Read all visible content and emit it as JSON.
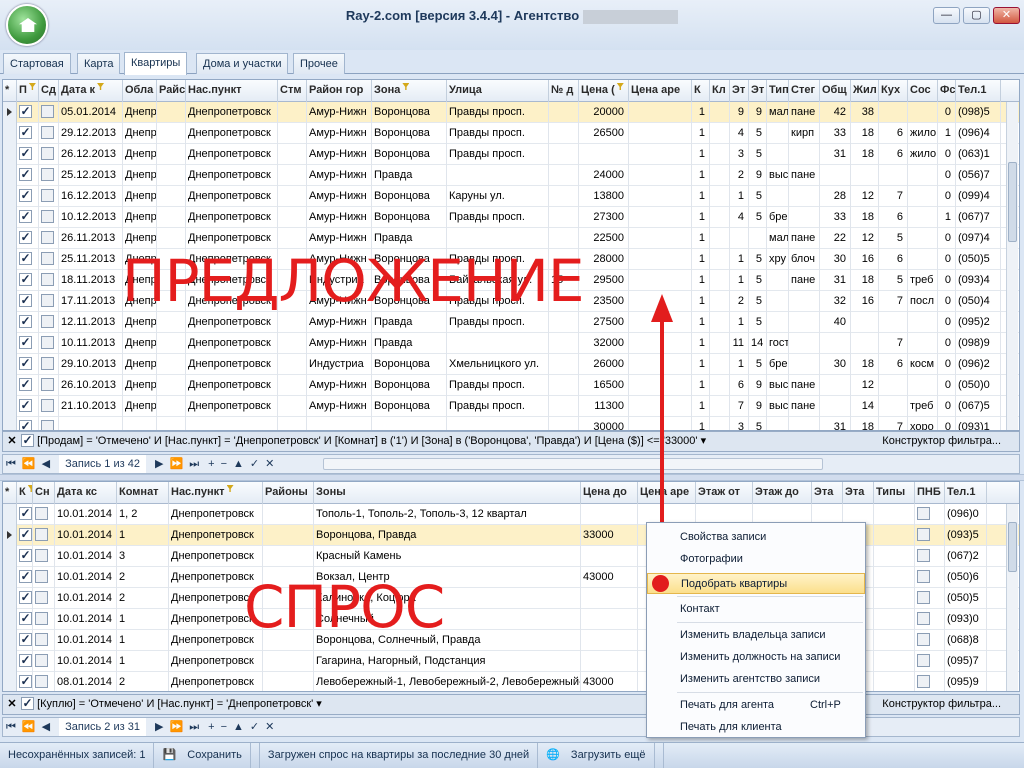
{
  "window": {
    "title": "Ray-2.com [версия 3.4.4] - Агентство",
    "min": "—",
    "max": "▢",
    "close": "✕"
  },
  "tabs": [
    {
      "label": "Стартовая"
    },
    {
      "label": "Карта"
    },
    {
      "label": "Квартиры"
    },
    {
      "label": "Дома и участки"
    },
    {
      "label": "Прочее"
    }
  ],
  "offers": {
    "headers": [
      "*",
      "П",
      "Сд",
      "Дата к",
      "Обла",
      "Райс",
      "Нас.пункт",
      "Стм",
      "Район гор",
      "Зона",
      "Улица",
      "№ д",
      "Цена (",
      "Цена аре",
      "К",
      "Кл",
      "Эт",
      "Эт",
      "Тип",
      "Стег",
      "Общ",
      "Жил",
      "Кух",
      "Сос",
      "Фс",
      "Тел.1"
    ],
    "rows": [
      [
        "05.01.2014",
        "Днепр",
        "",
        "Днепропетровск",
        "",
        "Амур-Нижн",
        "Воронцова",
        "Правды просп.",
        "",
        "20000",
        "",
        "1",
        "",
        "9",
        "9",
        "мал",
        "пане",
        "42",
        "38",
        "",
        "",
        "0",
        "(098)5"
      ],
      [
        "29.12.2013",
        "Днепр",
        "",
        "Днепропетровск",
        "",
        "Амур-Нижн",
        "Воронцова",
        "Правды просп.",
        "",
        "26500",
        "",
        "1",
        "",
        "4",
        "5",
        "",
        "кирп",
        "33",
        "18",
        "6",
        "жило",
        "1",
        "(096)4"
      ],
      [
        "26.12.2013",
        "Днепр",
        "",
        "Днепропетровск",
        "",
        "Амур-Нижн",
        "Воронцова",
        "Правды просп.",
        "",
        "",
        "",
        "1",
        "",
        "3",
        "5",
        "",
        "",
        "31",
        "18",
        "6",
        "жило",
        "0",
        "(063)1"
      ],
      [
        "25.12.2013",
        "Днепр",
        "",
        "Днепропетровск",
        "",
        "Амур-Нижн",
        "Правда",
        "",
        "",
        "24000",
        "",
        "1",
        "",
        "2",
        "9",
        "выс",
        "пане",
        "",
        "",
        "",
        "",
        "0",
        "(056)7"
      ],
      [
        "16.12.2013",
        "Днепр",
        "",
        "Днепропетровск",
        "",
        "Амур-Нижн",
        "Воронцова",
        "Каруны ул.",
        "",
        "13800",
        "",
        "1",
        "",
        "1",
        "5",
        "",
        "",
        "28",
        "12",
        "7",
        "",
        "0",
        "(099)4"
      ],
      [
        "10.12.2013",
        "Днепр",
        "",
        "Днепропетровск",
        "",
        "Амур-Нижн",
        "Воронцова",
        "Правды просп.",
        "",
        "27300",
        "",
        "1",
        "",
        "4",
        "5",
        "бре",
        "",
        "33",
        "18",
        "6",
        "",
        "1",
        "(067)7"
      ],
      [
        "26.11.2013",
        "Днепр",
        "",
        "Днепропетровск",
        "",
        "Амур-Нижн",
        "Правда",
        "",
        "",
        "22500",
        "",
        "1",
        "",
        "",
        "",
        "мал",
        "пане",
        "22",
        "12",
        "5",
        "",
        "0",
        "(097)4"
      ],
      [
        "25.11.2013",
        "Днепр",
        "",
        "Днепропетровск",
        "",
        "Амур-Нижн",
        "Воронцова",
        "Правды просп.",
        "",
        "28000",
        "",
        "1",
        "",
        "1",
        "5",
        "хру",
        "блоч",
        "30",
        "16",
        "6",
        "",
        "0",
        "(050)5"
      ],
      [
        "18.11.2013",
        "Днепр",
        "",
        "Днепропетровск",
        "",
        "Индустриа",
        "Воронцова",
        "Байкальская ул.",
        "15",
        "29500",
        "",
        "1",
        "",
        "1",
        "5",
        "",
        "пане",
        "31",
        "18",
        "5",
        "треб",
        "0",
        "(093)4"
      ],
      [
        "17.11.2013",
        "Днепр",
        "",
        "Днепропетровск",
        "",
        "Амур-Нижн",
        "Воронцова",
        "Правды просп.",
        "",
        "23500",
        "",
        "1",
        "",
        "2",
        "5",
        "",
        "",
        "32",
        "16",
        "7",
        "посл",
        "0",
        "(050)4"
      ],
      [
        "12.11.2013",
        "Днепр",
        "",
        "Днепропетровск",
        "",
        "Амур-Нижн",
        "Правда",
        "Правды просп.",
        "",
        "27500",
        "",
        "1",
        "",
        "1",
        "5",
        "",
        "",
        "40",
        "",
        "",
        "",
        "0",
        "(095)2"
      ],
      [
        "10.11.2013",
        "Днепр",
        "",
        "Днепропетровск",
        "",
        "Амур-Нижн",
        "Правда",
        "",
        "",
        "32000",
        "",
        "1",
        "",
        "11",
        "14",
        "гост",
        "",
        "",
        "",
        "7",
        "",
        "0",
        "(098)9"
      ],
      [
        "29.10.2013",
        "Днепр",
        "",
        "Днепропетровск",
        "",
        "Индустриа",
        "Воронцова",
        "Хмельницкого ул.",
        "",
        "26000",
        "",
        "1",
        "",
        "1",
        "5",
        "бре",
        "",
        "30",
        "18",
        "6",
        "косм",
        "0",
        "(096)2"
      ],
      [
        "26.10.2013",
        "Днепр",
        "",
        "Днепропетровск",
        "",
        "Амур-Нижн",
        "Воронцова",
        "Правды просп.",
        "",
        "16500",
        "",
        "1",
        "",
        "6",
        "9",
        "выс",
        "пане",
        "",
        "12",
        "",
        "",
        "0",
        "(050)0"
      ],
      [
        "21.10.2013",
        "Днепр",
        "",
        "Днепропетровск",
        "",
        "Амур-Нижн",
        "Воронцова",
        "Правды просп.",
        "",
        "11300",
        "",
        "1",
        "",
        "7",
        "9",
        "выс",
        "пане",
        "",
        "14",
        "",
        "треб",
        "0",
        "(067)5"
      ],
      [
        "",
        "",
        "",
        "",
        "",
        "",
        "",
        "",
        "",
        "30000",
        "",
        "1",
        "",
        "3",
        "5",
        "",
        "",
        "31",
        "18",
        "7",
        "хоро",
        "0",
        "(093)1"
      ]
    ],
    "filter": "[Продам] = 'Отмечено' И [Нас.пункт] = 'Днепропетровск' И [Комнат] в ('1') И [Зона] в ('Воронцова', 'Правда') И [Цена ($)] <= '33000'",
    "filter_builder": "Конструктор фильтра...",
    "record": "Запись 1 из 42"
  },
  "demands": {
    "headers": [
      "*",
      "К",
      "Сн",
      "Дата кс",
      "Комнат",
      "Нас.пункт",
      "Районы",
      "Зоны",
      "Цена до",
      "Цена аре",
      "Этаж от",
      "Этаж до",
      "Эта",
      "Эта",
      "Типы",
      "ПНБ",
      "Тел.1"
    ],
    "rows": [
      [
        "10.01.2014",
        "1, 2",
        "Днепропетровск",
        "",
        "Тополь-1, Тополь-2, Тополь-3, 12 квартал",
        "",
        "",
        "",
        "(096)0"
      ],
      [
        "10.01.2014",
        "1",
        "Днепропетровск",
        "",
        "Воронцова, Правда",
        "33000",
        "",
        "",
        "(093)5"
      ],
      [
        "10.01.2014",
        "3",
        "Днепропетровск",
        "",
        "Красный Камень",
        "",
        "",
        "",
        "(067)2"
      ],
      [
        "10.01.2014",
        "2",
        "Днепропетровск",
        "",
        "Вокзал, Центр",
        "43000",
        "",
        "",
        "(050)6"
      ],
      [
        "10.01.2014",
        "2",
        "Днепропетровск",
        "",
        "Калиновка, Коцюра",
        "",
        "",
        "",
        "(050)5"
      ],
      [
        "10.01.2014",
        "1",
        "Днепропетровск",
        "",
        "Солнечный",
        "",
        "",
        "",
        "(093)0"
      ],
      [
        "10.01.2014",
        "1",
        "Днепропетровск",
        "",
        "Воронцова, Солнечный, Правда",
        "",
        "",
        "",
        "(068)8"
      ],
      [
        "10.01.2014",
        "1",
        "Днепропетровск",
        "",
        "Гагарина, Нагорный, Подстанция",
        "",
        "",
        "",
        "(095)7"
      ],
      [
        "08.01.2014",
        "2",
        "Днепропетровск",
        "",
        "Левобережный-1, Левобережный-2, Левобережный-3",
        "43000",
        "",
        "",
        "(095)9"
      ]
    ],
    "filter": "[Куплю] = 'Отмечено' И [Нас.пункт] = 'Днепропетровск'",
    "filter_builder": "Конструктор фильтра...",
    "record": "Запись 2 из 31"
  },
  "context_menu": {
    "items": [
      {
        "label": "Свойства записи"
      },
      {
        "label": "Фотографии"
      },
      {
        "label": "Подобрать квартиры"
      },
      {
        "label": "Контакт"
      },
      {
        "label": "Изменить владельца записи"
      },
      {
        "label": "Изменить должность на записи"
      },
      {
        "label": "Изменить агентство записи"
      },
      {
        "label": "Печать для агента",
        "shortcut": "Ctrl+P"
      },
      {
        "label": "Печать для клиента"
      }
    ]
  },
  "overlay": {
    "offer_text": "ПРЕДЛОЖЕНИЕ",
    "demand_text": "СПРОС"
  },
  "status": {
    "unsaved": "Несохранённых записей: 1",
    "save": "Сохранить",
    "loaded": "Загружен спрос на квартиры за последние 30 дней",
    "load_more": "Загрузить ещё"
  },
  "colors": {
    "annotation": "#e21d1d",
    "selected_row": "#fdf1c8",
    "menu_highlight": "#fbdf8c"
  }
}
